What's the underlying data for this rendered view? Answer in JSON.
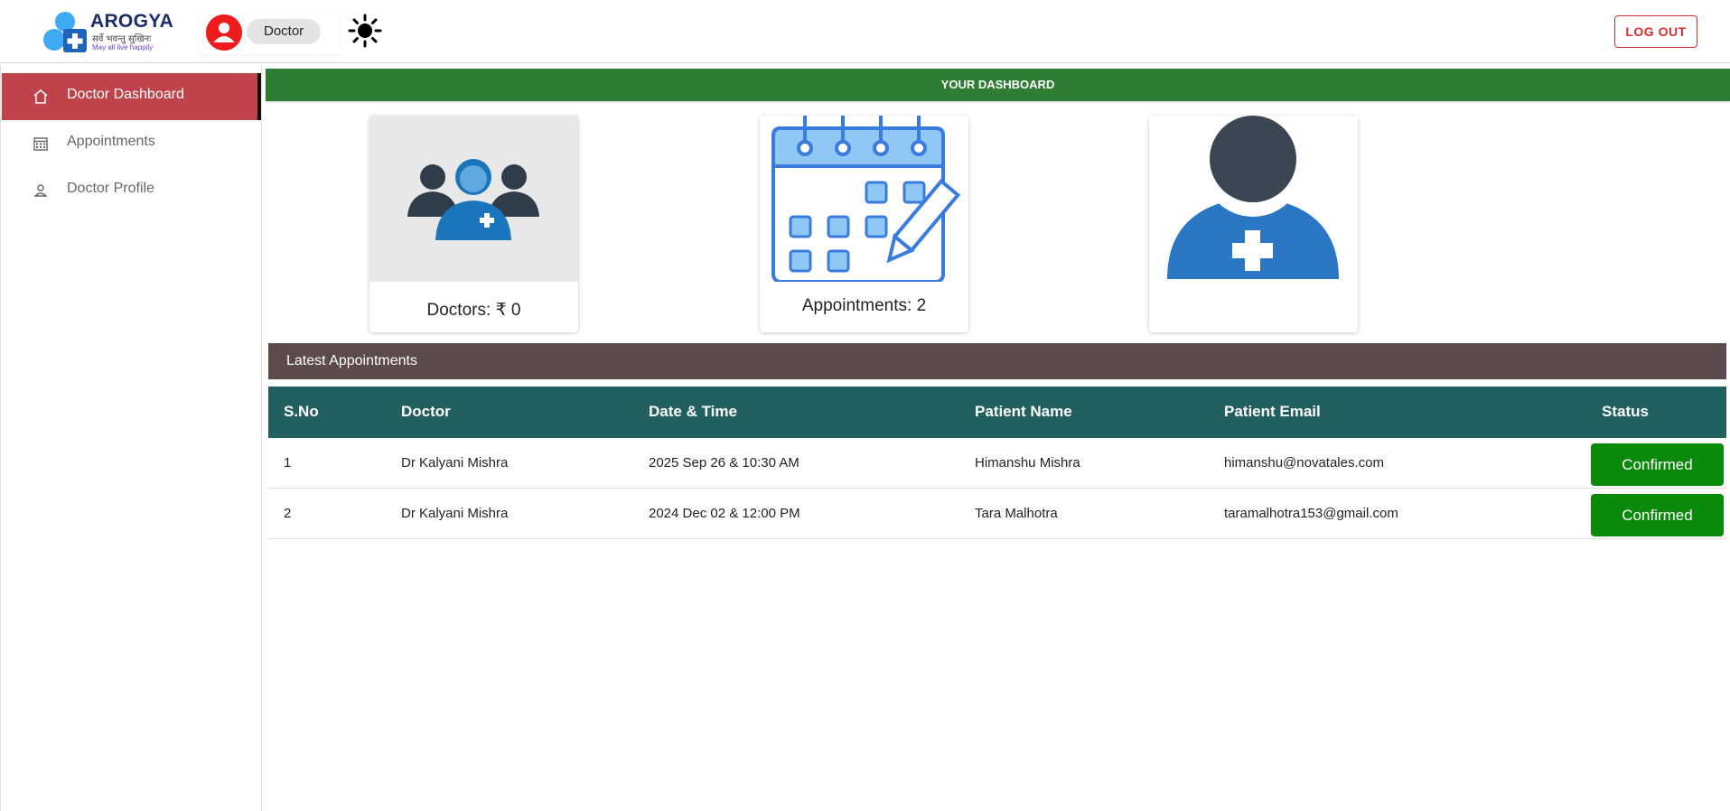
{
  "header": {
    "logo": {
      "title": "AROGYA",
      "hindi": "सर्वे भवन्तु सुखिनः",
      "tagline": "May all live happily"
    },
    "role": "Doctor",
    "logout_label": "LOG OUT"
  },
  "sidebar": {
    "items": [
      {
        "label": "Doctor Dashboard",
        "icon": "home-icon",
        "active": true
      },
      {
        "label": "Appointments",
        "icon": "calendar-icon",
        "active": false
      },
      {
        "label": "Doctor Profile",
        "icon": "person-icon",
        "active": false
      }
    ]
  },
  "banner": "YOUR DASHBOARD",
  "cards": [
    {
      "label": "Doctors: ₹ 0",
      "icon": "doctors-group-icon"
    },
    {
      "label": "Appointments: 2",
      "icon": "calendar-schedule-icon"
    },
    {
      "label": "",
      "icon": "medical-person-icon"
    }
  ],
  "latest_title": "Latest Appointments",
  "table": {
    "headers": [
      "S.No",
      "Doctor",
      "Date & Time",
      "Patient Name",
      "Patient Email",
      "Status"
    ],
    "rows": [
      [
        "1",
        "Dr Kalyani Mishra",
        "2025 Sep 26 & 10:30 AM",
        "Himanshu Mishra",
        "himanshu@novatales.com",
        "Confirmed"
      ],
      [
        "2",
        "Dr Kalyani Mishra",
        "2024 Dec 02 & 12:00 PM",
        "Tara Malhotra",
        "taramalhotra153@gmail.com",
        "Confirmed"
      ]
    ]
  },
  "colors": {
    "banner": "#2e7d32",
    "active_nav": "#c0434a",
    "table_header": "#226060",
    "latest_bar": "#5d4a4b",
    "status_confirmed": "#0a8a0a",
    "logout": "#d32f2f"
  }
}
